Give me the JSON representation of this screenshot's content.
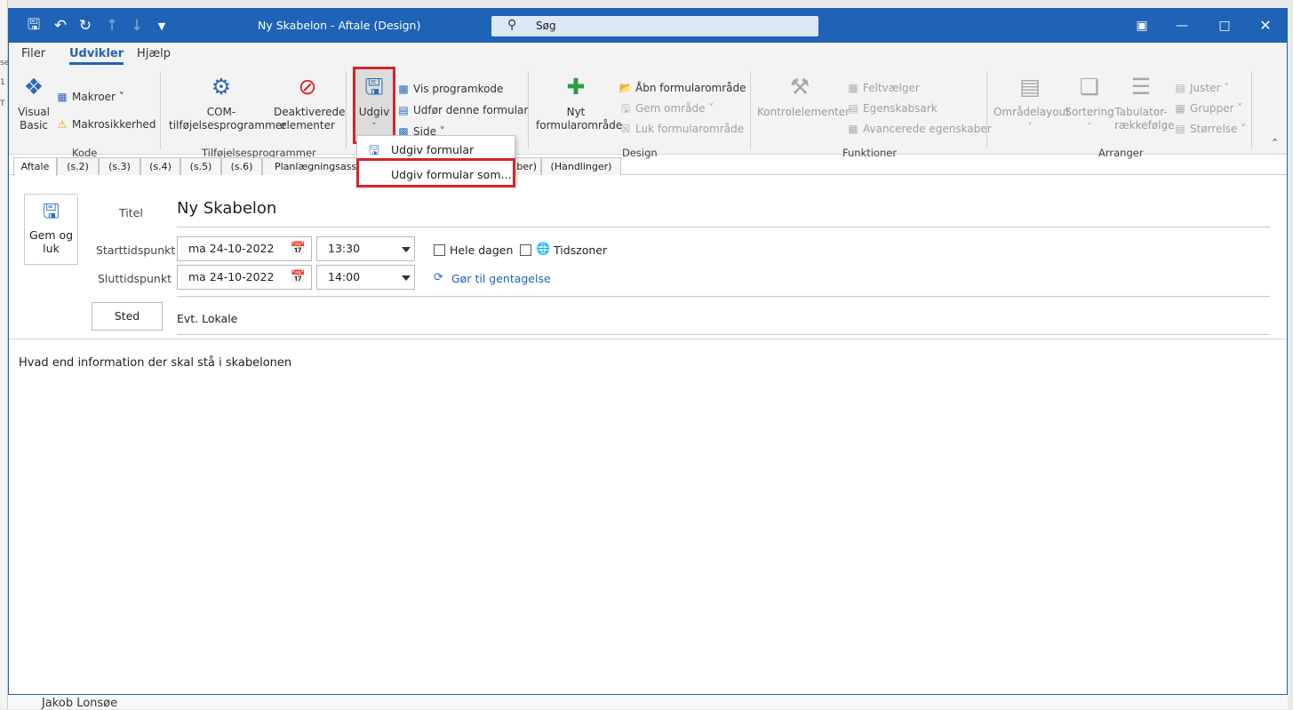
{
  "window": {
    "title": "Ny Skabelon  -  Aftale  (Design)",
    "search_placeholder": "Søg"
  },
  "menu": {
    "tabs": [
      "Filer",
      "Udvikler",
      "Hjælp"
    ],
    "active": "Udvikler"
  },
  "ribbon": {
    "groups": {
      "kode": "Kode",
      "tilfoejelser": "Tilføjelsesprogrammer",
      "design": "Design",
      "funktioner": "Funktioner",
      "arranger": "Arranger"
    },
    "visual_basic": {
      "line1": "Visual",
      "line2": "Basic"
    },
    "makroer": "Makroer",
    "makrosikkerhed": "Makrosikkerhed",
    "com": {
      "line1": "COM-",
      "line2": "tilføjelsesprogrammer"
    },
    "deaktiverede": {
      "line1": "Deaktiverede",
      "line2": "elementer"
    },
    "udgiv": "Udgiv",
    "vis_programkode": "Vis programkode",
    "udfoer_formular": "Udfør denne formular",
    "side": "Side",
    "nyt_formularomraade": {
      "line1": "Nyt",
      "line2": "formularområde"
    },
    "aabn_formularomraade": "Åbn formularområde",
    "gem_omraade": "Gem område",
    "luk_formularomraade": "Luk formularområde",
    "kontrolelementer": "Kontrolelementer",
    "feltvaelger": "Feltvælger",
    "egenskabsark": "Egenskabsark",
    "avancerede_egenskaber": "Avancerede egenskaber",
    "omraadelayout": "Områdelayout",
    "sortering": "Sortering",
    "tabulator": {
      "line1": "Tabulator-",
      "line2": "rækkefølge"
    },
    "juster": "Juster",
    "grupper": "Grupper",
    "stoerrelse": "Størrelse"
  },
  "dropdown": {
    "items": [
      "Udgiv formular",
      "Udgiv formular som..."
    ]
  },
  "form_tabs": [
    "Aftale",
    "(s.2)",
    "(s.3)",
    "(s.4)",
    "(s.5)",
    "(s.6)",
    "Planlægningsassis",
    "ber)",
    "(Handlinger)"
  ],
  "form": {
    "gem_og_luk": {
      "line1": "Gem og",
      "line2": "luk"
    },
    "titel_label": "Titel",
    "titel_value": "Ny Skabelon",
    "start_label": "Starttidspunkt",
    "start_date": "ma 24-10-2022",
    "start_time": "13:30",
    "slut_label": "Sluttidspunkt",
    "slut_date": "ma 24-10-2022",
    "slut_time": "14:00",
    "hele_dagen": "Hele dagen",
    "tidszoner": "Tidszoner",
    "gentagelse": "Gør til gentagelse",
    "sted_button": "Sted",
    "sted_value": "Evt. Lokale",
    "body": "Hvad end information der skal stå i skabelonen"
  },
  "background": {
    "bottom_name": "Jakob Lonsøe"
  },
  "colors": {
    "accent": "#1e63b5",
    "highlight_box": "#d5242c"
  }
}
